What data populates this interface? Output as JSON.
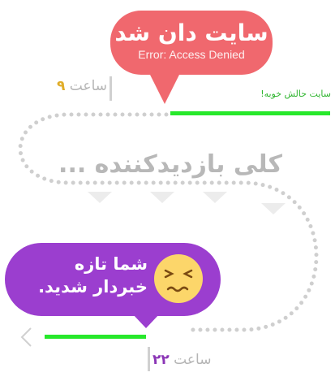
{
  "top_bubble": {
    "title": "سایت دان شد",
    "subtitle": "Error: Access  Denied",
    "color": "#f0686e"
  },
  "time_start": {
    "label": "ساعت",
    "hour": "۹"
  },
  "status_ok": "سایت حالش خوبه!",
  "visitors_text": "کلی بازدیدکننده ...",
  "purple_bubble": {
    "line1": "شما تازه",
    "line2": "خبردار شدید.",
    "color": "#9b3ecf",
    "emoji": "face-with-closed-eyes-icon"
  },
  "time_end": {
    "label": "ساعت",
    "hour": "۲۲"
  },
  "colors": {
    "green_bar": "#27e82b",
    "dotted_path": "#cfcfcf",
    "emoji_face": "#fcd66a"
  }
}
